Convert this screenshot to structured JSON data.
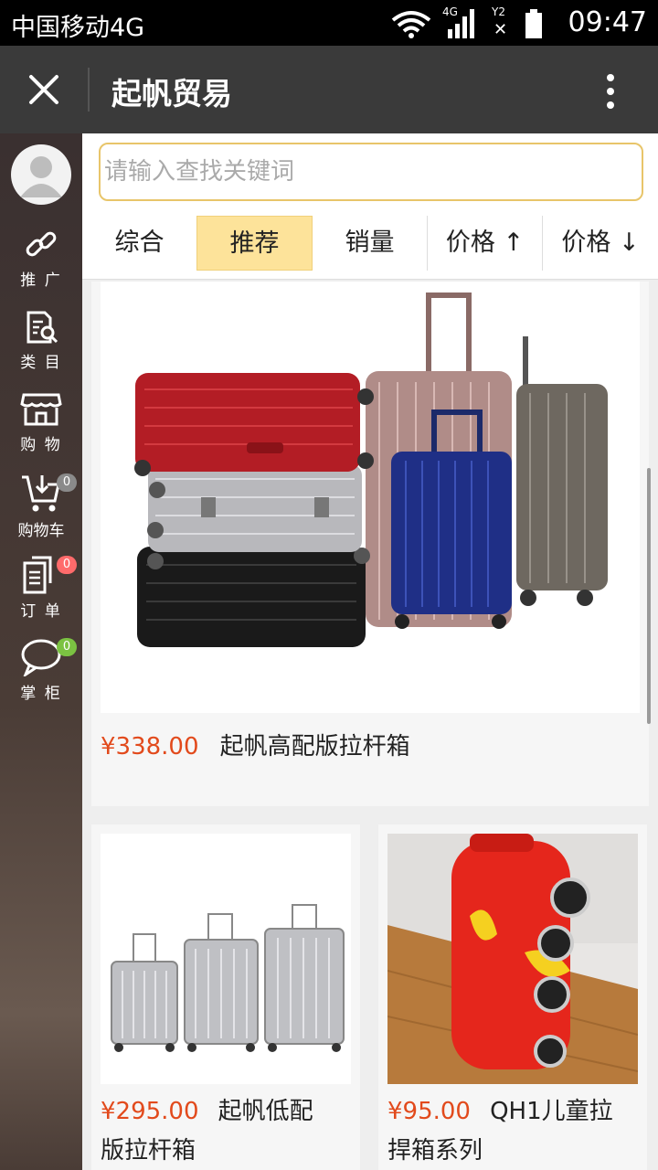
{
  "status": {
    "carrier": "中国移动4G",
    "net1": "4G",
    "net2": "Y2",
    "time": "09:47"
  },
  "titlebar": {
    "title": "起帆贸易"
  },
  "sidebar": {
    "items": [
      {
        "label": "推 广",
        "icon": "link-icon"
      },
      {
        "label": "类 目",
        "icon": "category-search-icon"
      },
      {
        "label": "购 物",
        "icon": "shop-icon"
      },
      {
        "label": "购物车",
        "icon": "cart-icon",
        "badge": "0"
      },
      {
        "label": "订 单",
        "icon": "order-icon",
        "badge": "0"
      },
      {
        "label": "掌 柜",
        "icon": "chat-icon",
        "badge": "0"
      }
    ]
  },
  "search": {
    "placeholder": "请输入查找关键词"
  },
  "sort": {
    "tabs": [
      "综合",
      "推荐",
      "销量",
      "价格 ↑",
      "价格 ↓"
    ],
    "active": "推荐"
  },
  "products": [
    {
      "price": "¥338.00",
      "name": "起帆高配版拉杆箱"
    },
    {
      "price": "¥295.00",
      "name_line1": "起帆低配",
      "name_line2": "版拉杆箱"
    },
    {
      "price": "¥95.00",
      "name_line1": "QH1儿童拉",
      "name_line2": "捍箱系列"
    }
  ],
  "colors": {
    "accent": "#fde39a",
    "price": "#e24a1c",
    "search_border": "#e8c56a"
  }
}
